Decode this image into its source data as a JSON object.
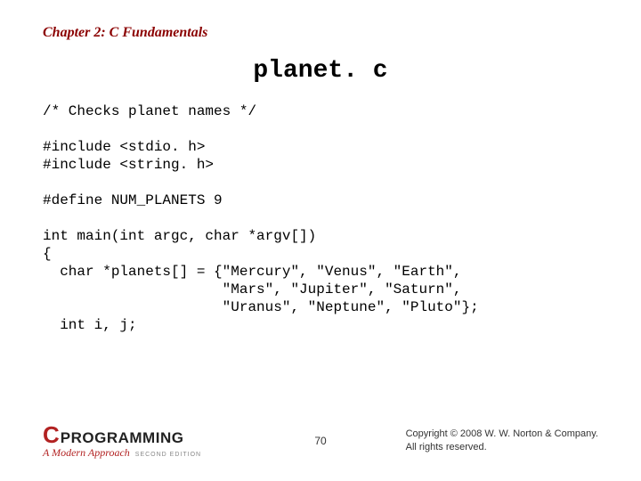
{
  "chapter": "Chapter 2: C Fundamentals",
  "title": "planet. c",
  "code": "/* Checks planet names */\n\n#include <stdio. h>\n#include <string. h>\n\n#define NUM_PLANETS 9\n\nint main(int argc, char *argv[])\n{\n  char *planets[] = {\"Mercury\", \"Venus\", \"Earth\",\n                     \"Mars\", \"Jupiter\", \"Saturn\",\n                     \"Uranus\", \"Neptune\", \"Pluto\"};\n  int i, j;",
  "logo": {
    "c": "C",
    "word": "PROGRAMMING",
    "sub": "A Modern Approach",
    "edition": "SECOND EDITION"
  },
  "page": "70",
  "copyright": {
    "line1": "Copyright © 2008 W. W. Norton & Company.",
    "line2": "All rights reserved."
  }
}
